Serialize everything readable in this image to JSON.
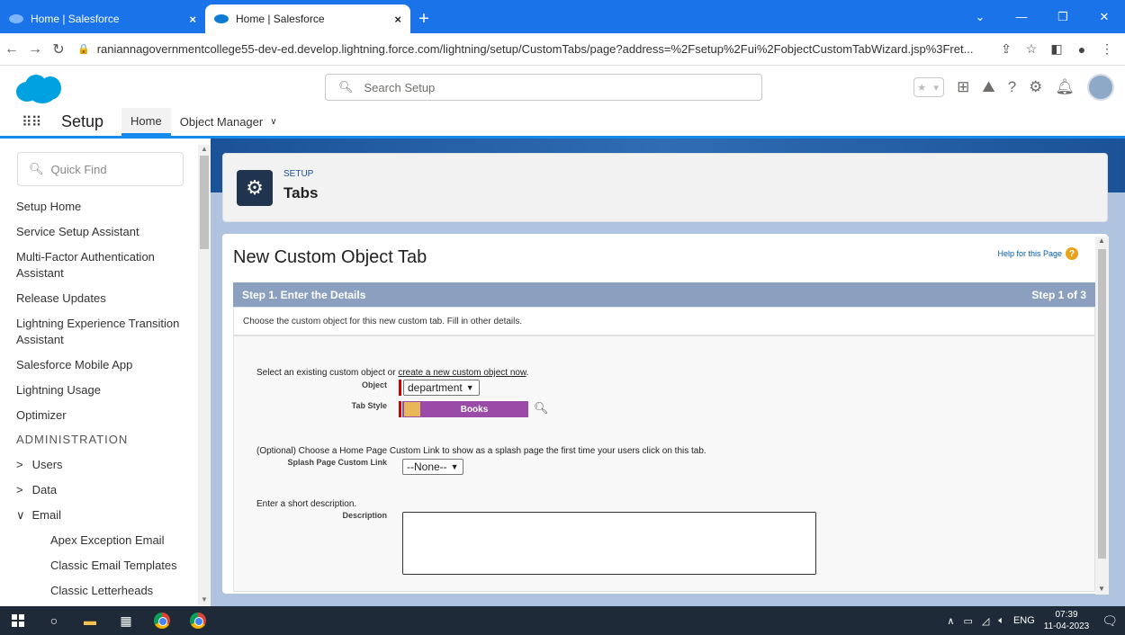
{
  "browser": {
    "tabs": [
      {
        "title": "Home | Salesforce",
        "close": "×"
      },
      {
        "title": "Home | Salesforce",
        "close": "×"
      }
    ],
    "new_tab": "+",
    "url": "raniannagovernmentcollege55-dev-ed.develop.lightning.force.com/lightning/setup/CustomTabs/page?address=%2Fsetup%2Fui%2FobjectCustomTabWizard.jsp%3Fret..."
  },
  "header": {
    "search_placeholder": "Search Setup"
  },
  "setup_nav": {
    "app_label": "Setup",
    "tabs": [
      {
        "label": "Home"
      },
      {
        "label": "Object Manager"
      }
    ]
  },
  "sidebar": {
    "quick_find_placeholder": "Quick Find",
    "items": [
      "Setup Home",
      "Service Setup Assistant",
      "Multi-Factor Authentication Assistant",
      "Release Updates",
      "Lightning Experience Transition Assistant",
      "Salesforce Mobile App",
      "Lightning Usage",
      "Optimizer"
    ],
    "admin_heading": "ADMINISTRATION",
    "admin_items": [
      {
        "chevron": ">",
        "label": "Users"
      },
      {
        "chevron": ">",
        "label": "Data"
      },
      {
        "chevron": "∨",
        "label": "Email"
      }
    ],
    "email_items": [
      "Apex Exception Email",
      "Classic Email Templates",
      "Classic Letterheads"
    ]
  },
  "setup_header": {
    "label": "SETUP",
    "title": "Tabs"
  },
  "main": {
    "title": "New Custom Object Tab",
    "help_link": "Help for this Page",
    "step_title": "Step 1. Enter the Details",
    "step_count": "Step 1 of 3",
    "step_description": "Choose the custom object for this new custom tab. Fill in other details.",
    "select_object_text": "Select an existing custom object or",
    "create_link": "create a new custom object now",
    "create_link_suffix": ".",
    "object_label": "Object",
    "object_value": "department",
    "tab_style_label": "Tab Style",
    "tab_style_value": "Books",
    "splash_text": "(Optional) Choose a Home Page Custom Link to show as a splash page the first time your users click on this tab.",
    "splash_label": "Splash Page Custom Link",
    "splash_value": "--None--",
    "desc_prompt": "Enter a short description.",
    "desc_label": "Description"
  },
  "taskbar": {
    "language": "ENG",
    "time": "07:39",
    "date": "11-04-2023"
  },
  "colors": {
    "chrome_blue": "#1a73e8",
    "salesforce_blue": "#00a1e0",
    "step_bar": "#8b9fbf",
    "tab_style_purple": "#9a4ba8"
  }
}
